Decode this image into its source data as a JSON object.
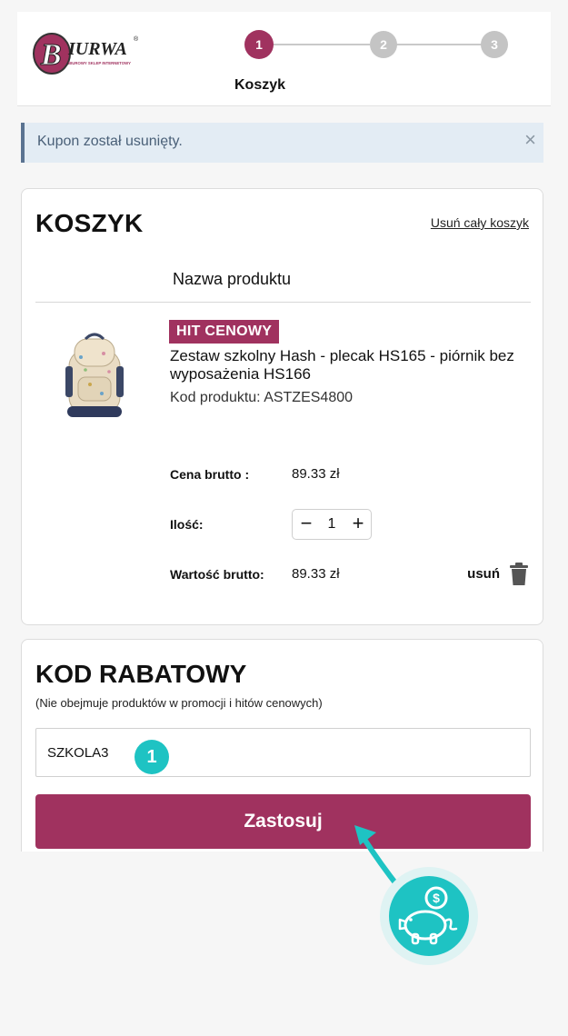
{
  "header": {
    "logo_text": "BIURWA",
    "logo_tagline": "BIUROWY SKLEP INTERNETOWY",
    "steps": [
      "1",
      "2",
      "3"
    ],
    "active_step_label": "Koszyk"
  },
  "alert": {
    "message": "Kupon został usunięty.",
    "close": "×"
  },
  "cart": {
    "title": "KOSZYK",
    "clear_label": "Usuń cały koszyk",
    "column_header": "Nazwa produktu",
    "item": {
      "badge": "HIT CENOWY",
      "name": "Zestaw szkolny Hash - plecak HS165 - piórnik bez wyposażenia HS166",
      "code": "Kod produktu: ASTZES4800",
      "price_label": "Cena brutto :",
      "price_value": "89.33 zł",
      "qty_label": "Ilość:",
      "qty_minus": "−",
      "qty_value": "1",
      "qty_plus": "+",
      "total_label": "Wartość brutto:",
      "total_value": "89.33 zł",
      "remove_label": "usuń"
    }
  },
  "coupon": {
    "title": "KOD RABATOWY",
    "note": "(Nie obejmuje produktów w promocji i hitów cenowych)",
    "value": "SZKOLA3",
    "apply_label": "Zastosuj"
  },
  "overlay": {
    "marker": "1",
    "piggy_symbol": "$"
  },
  "colors": {
    "brand": "#a0325f",
    "accent": "#1ec3c3",
    "alert_bg": "#e3ecf4"
  }
}
